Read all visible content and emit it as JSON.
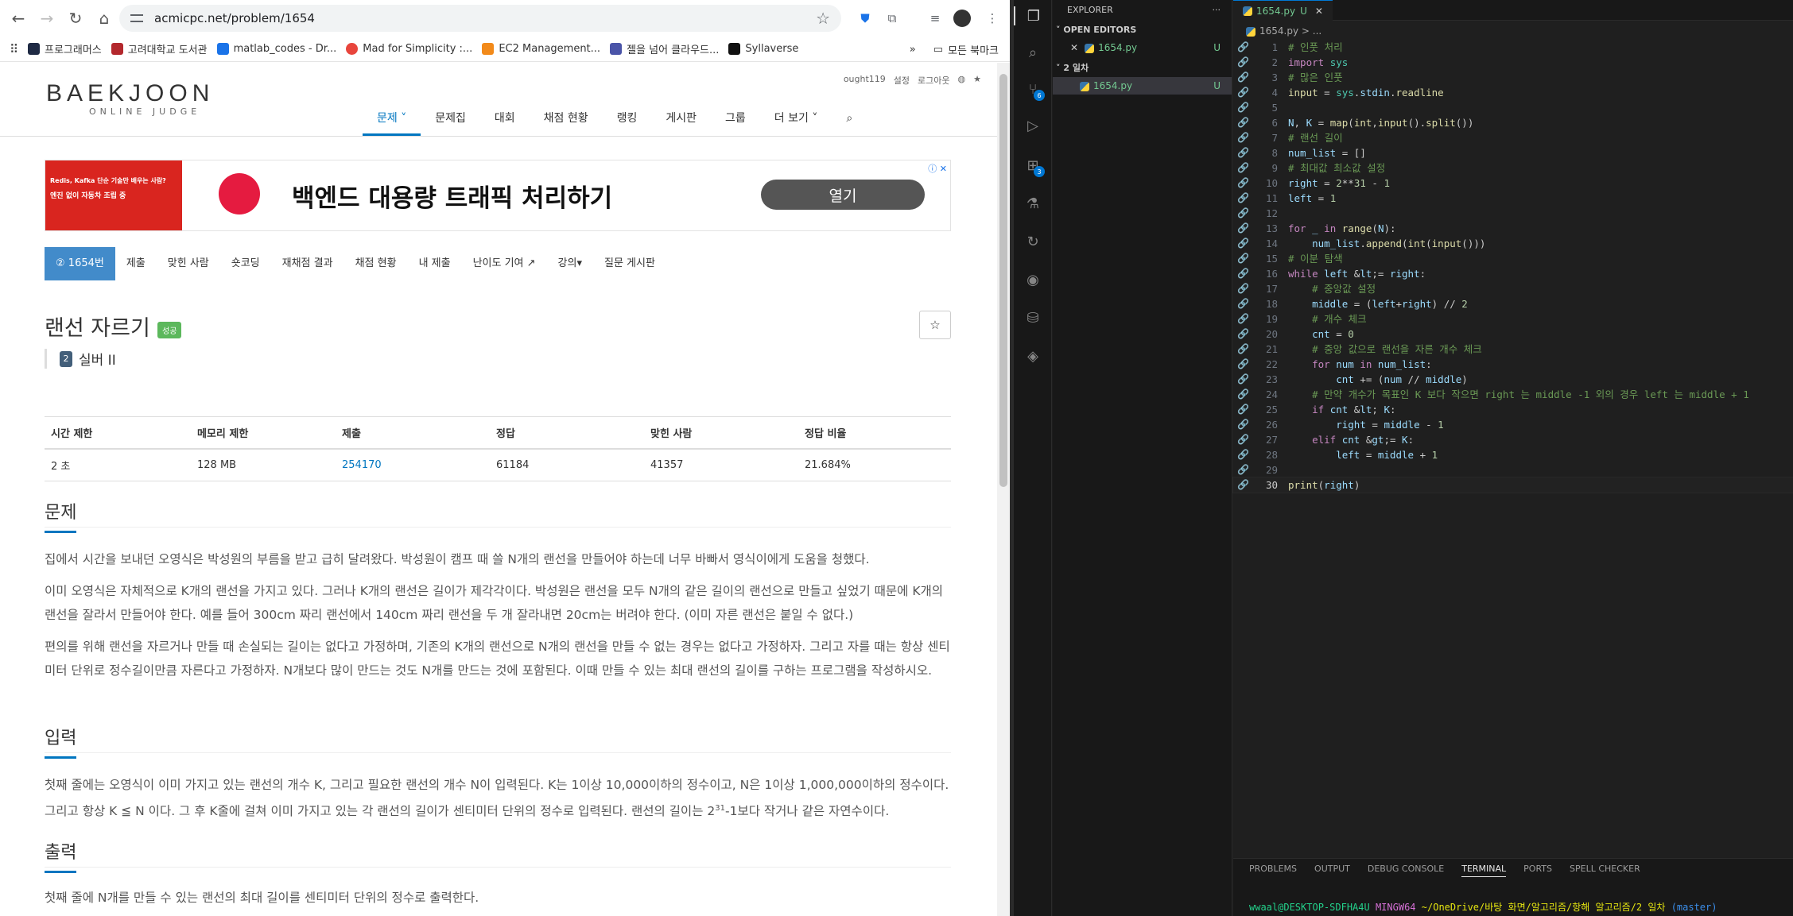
{
  "browser": {
    "url": "acmicpc.net/problem/1654",
    "bookmarks": [
      "프로그래머스",
      "고려대학교 도서관",
      "matlab_codes - Dr...",
      "Mad for Simplicity :...",
      "EC2 Management...",
      "젤을 넘어 클라우드...",
      "Syllaverse"
    ],
    "bookmark_colors": [
      "#1f2a44",
      "#b3282d",
      "#1a73e8",
      "#e8453c",
      "#f28a1a",
      "#4a54a8",
      "#111111"
    ],
    "all_bookmarks": "모든 북마크"
  },
  "site": {
    "logo": "BAEKJOON",
    "logo_sub": "ONLINE JUDGE",
    "top_links": [
      "ought119",
      "설정",
      "로그아웃"
    ],
    "main_nav": [
      "문제",
      "문제집",
      "대회",
      "채점 현황",
      "랭킹",
      "게시판",
      "그룹",
      "더 보기"
    ],
    "ad": {
      "title": "백엔드 대용량 트래픽 처리하기",
      "button": "열기",
      "small_lines": [
        "Redis, Kafka 단순 기술만 배우는 사람?",
        "엔진 없이 자동차 조립 중"
      ]
    },
    "sub_nav": [
      "1654번",
      "제출",
      "맞힌 사람",
      "숏코딩",
      "재채점 결과",
      "채점 현황",
      "내 제출",
      "난이도 기여",
      "강의",
      "질문 게시판"
    ],
    "problem_title": "랜선 자르기",
    "success_badge": "성공",
    "tier": "실버 II",
    "tier_num": "2",
    "table": {
      "headers": [
        "시간 제한",
        "메모리 제한",
        "제출",
        "정답",
        "맞힌 사람",
        "정답 비율"
      ],
      "values": [
        "2 초",
        "128 MB",
        "254170",
        "61184",
        "41357",
        "21.684%"
      ]
    },
    "sections": {
      "problem": "문제",
      "input": "입력",
      "output": "출력"
    },
    "problem_paras": [
      "집에서 시간을 보내던 오영식은 박성원의 부름을 받고 급히 달려왔다. 박성원이 캠프 때 쓸 N개의 랜선을 만들어야 하는데 너무 바빠서 영식이에게 도움을 청했다.",
      "이미 오영식은 자체적으로 K개의 랜선을 가지고 있다. 그러나 K개의 랜선은 길이가 제각각이다. 박성원은 랜선을 모두 N개의 같은 길이의 랜선으로 만들고 싶었기 때문에 K개의 랜선을 잘라서 만들어야 한다. 예를 들어 300cm 짜리 랜선에서 140cm 짜리 랜선을 두 개 잘라내면 20cm는 버려야 한다. (이미 자른 랜선은 붙일 수 없다.)",
      "편의를 위해 랜선을 자르거나 만들 때 손실되는 길이는 없다고 가정하며, 기존의 K개의 랜선으로 N개의 랜선을 만들 수 없는 경우는 없다고 가정하자. 그리고 자를 때는 항상 센티미터 단위로 정수길이만큼 자른다고 가정하자. N개보다 많이 만드는 것도 N개를 만드는 것에 포함된다. 이때 만들 수 있는 최대 랜선의 길이를 구하는 프로그램을 작성하시오."
    ],
    "input_para_1": "첫째 줄에는 오영식이 이미 가지고 있는 랜선의 개수 K, 그리고 필요한 랜선의 개수 N이 입력된다. K는 1이상 10,000이하의 정수이고, N은 1이상 1,000,000이하의 정수이다. 그리고 항상 K ≦ N 이다. 그 후 K줄에 걸쳐 이미 가지고 있는 각 랜선의 길이가 센티미터 단위의 정수로 입력된다. 랜선의 길이는 2",
    "input_sup": "31",
    "input_para_2": "-1보다 작거나 같은 자연수이다.",
    "output_para": "첫째 줄에 N개를 만들 수 있는 랜선의 최대 길이를 센티미터 단위의 정수로 출력한다."
  },
  "vscode": {
    "explorer_title": "EXPLORER",
    "open_editors": "OPEN EDITORS",
    "folder": "2 일차",
    "file": "1654.py",
    "file_status": "U",
    "tab": "1654.py",
    "breadcrumb": "1654.py > ...",
    "badge_scm": "6",
    "badge_ext": "3",
    "code_lines": [
      "# 인풋 처리",
      "import sys",
      "# 많은 인풋",
      "input = sys.stdin.readline",
      "",
      "N, K = map(int,input().split())",
      "# 랜선 길이",
      "num_list = []",
      "# 최대값 최소값 설정",
      "right = 2**31 - 1",
      "left = 1",
      "",
      "for _ in range(N):",
      "    num_list.append(int(input()))",
      "# 이분 탐색",
      "while left <= right:",
      "    # 중앙값 설정",
      "    middle = (left+right) // 2",
      "    # 개수 체크",
      "    cnt = 0",
      "    # 중앙 값으로 랜선을 자른 개수 체크",
      "    for num in num_list:",
      "        cnt += (num // middle)",
      "    # 만약 개수가 목표인 K 보다 작으면 right 는 middle -1 외의 경우 left 는 middle + 1",
      "    if cnt < K:",
      "        right = middle - 1",
      "    elif cnt >= K:",
      "        left = middle + 1",
      "",
      "print(right)"
    ],
    "panel_tabs": [
      "PROBLEMS",
      "OUTPUT",
      "DEBUG CONSOLE",
      "TERMINAL",
      "PORTS",
      "SPELL CHECKER"
    ],
    "terminal_user": "wwaal@DESKTOP-SDFHA4U",
    "terminal_env": "MINGW64",
    "terminal_path": "~/OneDrive/바탕 화면/알고리즘/항해 알고리즘/2 일차",
    "terminal_branch": "(master)"
  }
}
